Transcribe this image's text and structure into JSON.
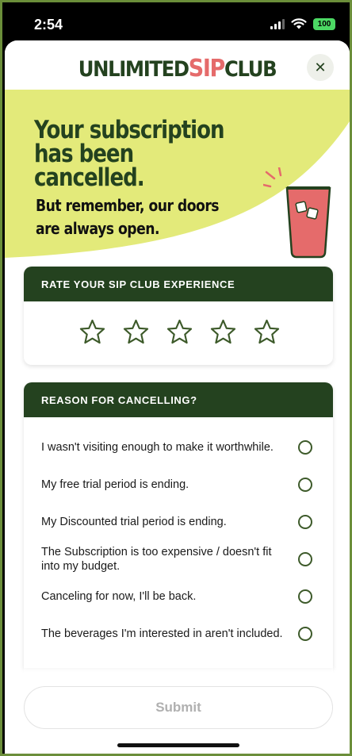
{
  "status_bar": {
    "time": "2:54",
    "battery": "100"
  },
  "header": {
    "logo_part1": "UNLIMITED",
    "logo_part2": "SIP",
    "logo_part3": "CLUB",
    "close_label": "✕"
  },
  "hero": {
    "title": "Your subscription has been cancelled.",
    "subtitle": "But remember, our doors are always open."
  },
  "rating": {
    "heading": "RATE YOUR SIP CLUB EXPERIENCE",
    "stars": [
      "star-1",
      "star-2",
      "star-3",
      "star-4",
      "star-5"
    ]
  },
  "reasons": {
    "heading": "REASON FOR CANCELLING?",
    "options": [
      "I wasn't visiting enough to make it worthwhile.",
      "My free trial period is ending.",
      "My Discounted trial period is ending.",
      "The Subscription is too expensive / doesn't fit into my budget.",
      "Canceling for now, I'll be back.",
      "The beverages I'm interested in aren't included."
    ]
  },
  "submit": {
    "label": "Submit"
  },
  "colors": {
    "brand_green": "#24421f",
    "brand_pink": "#e56b6b",
    "hero_yellow": "#e3ea7a",
    "frame_green": "#6b8e3a"
  }
}
